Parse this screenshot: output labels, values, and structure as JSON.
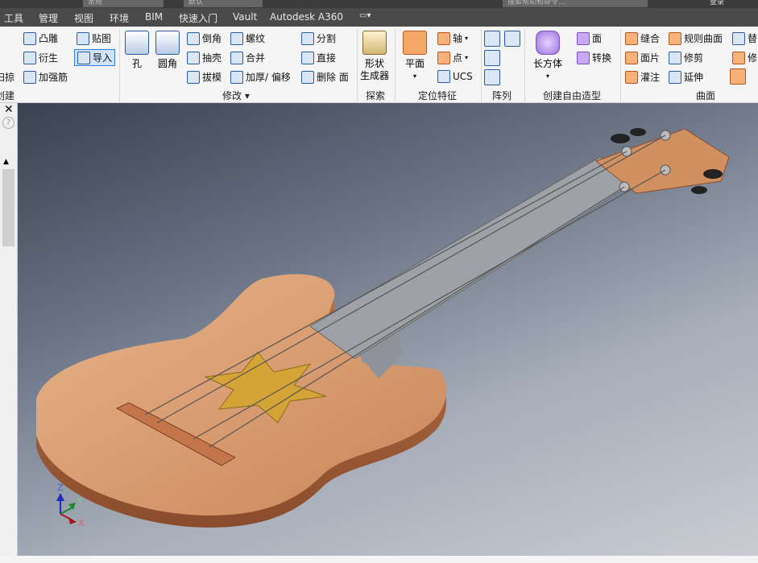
{
  "titlebar": {
    "style_field": "常规",
    "material_field": "默认",
    "search_placeholder": "搜索帮助和命令...",
    "sign_in": "登录"
  },
  "menu_tabs": [
    "工具",
    "管理",
    "视图",
    "环境",
    "BIM",
    "快速入门",
    "Vault",
    "Autodesk A360"
  ],
  "ribbon": {
    "create": {
      "items": [
        "凸雕",
        "衍生",
        "加强筋",
        "贴图",
        "导入",
        "扫掠"
      ],
      "label": "创建"
    },
    "modify": {
      "hole": "孔",
      "fillet": "圆角",
      "items": [
        "倒角",
        "抽壳",
        "拔模",
        "螺纹",
        "合并",
        "加厚/ 偏移",
        "分割",
        "直接",
        "删除 面"
      ],
      "label": "修改"
    },
    "explore": {
      "shape_gen": [
        "形状",
        "生成器"
      ],
      "label": "探索"
    },
    "work_features": {
      "plane": "平面",
      "axis": "轴",
      "point": "点",
      "ucs": "UCS",
      "label": "定位特征"
    },
    "pattern": {
      "label": "阵列"
    },
    "freeform": {
      "box": "长方体",
      "face": "面",
      "convert": "转换",
      "label": "创建自由造型"
    },
    "surface": {
      "items": [
        "缝合",
        "面片",
        "灌注",
        "规则曲面",
        "修剪",
        "延伸",
        "替",
        "修"
      ],
      "label": "曲面"
    }
  },
  "triad": {
    "x": "X",
    "y": "Y",
    "z": "Z"
  },
  "colors": {
    "body": "#d9996a",
    "fretboard": "#9ea2a6",
    "star": "#d4a437"
  }
}
